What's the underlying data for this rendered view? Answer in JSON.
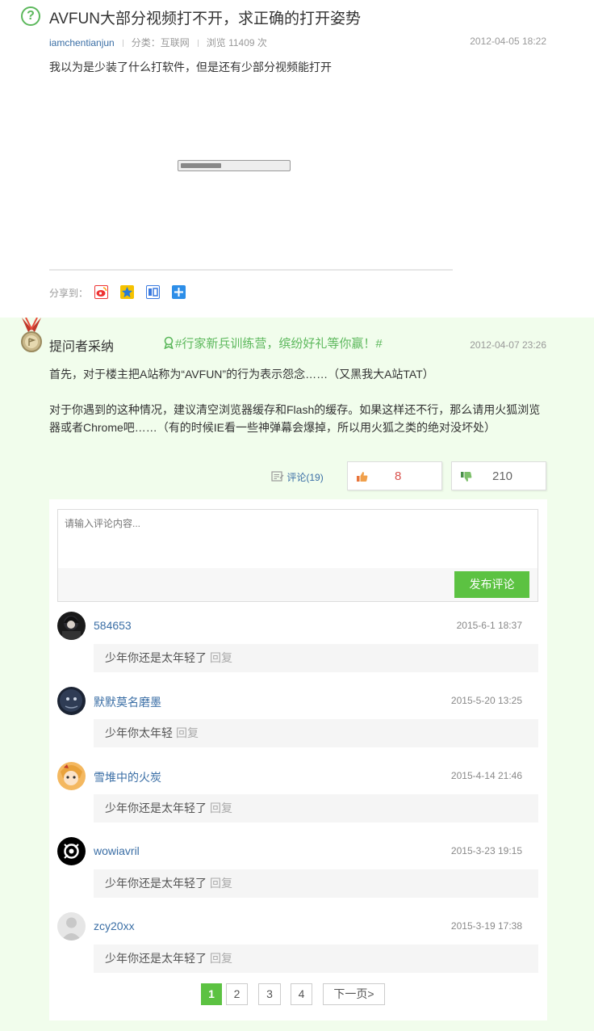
{
  "question": {
    "title": "AVFUN大部分视频打不开，求正确的打开姿势",
    "author": "iamchentianjun",
    "category": "分类：互联网",
    "views": "浏览 11409 次",
    "date": "2012-04-05 18:22",
    "body": "我以为是少装了什么打软件，但是还有少部分视频能打开",
    "share_label": "分享到："
  },
  "share_icons": [
    "weibo-icon",
    "qzone-icon",
    "tieba-icon",
    "more-share-icon"
  ],
  "answer": {
    "adopt_label": "提问者采纳",
    "promo": "#行家新兵训练营，缤纷好礼等你赢！#",
    "date": "2012-04-07 23:26",
    "para1": "首先，对于楼主把A站称为“AVFUN”的行为表示怨念……（又黑我大A站TAT）",
    "para2": "对于你遇到的这种情况，建议清空浏览器缓存和Flash的缓存。如果这样还不行，那么请用火狐浏览器或者Chrome吧……（有的时候IE看一些神弹幕会爆掉，所以用火狐之类的绝对没坏处）",
    "comment_link": "评论(19)",
    "upvotes": "8",
    "downvotes": "210"
  },
  "comment_form": {
    "placeholder": "请输入评论内容...",
    "submit_label": "发布评论"
  },
  "comments": [
    {
      "user": "584653",
      "date": "2015-6-1 18:37",
      "text": "少年你还是太年轻了",
      "reply": "回复"
    },
    {
      "user": "默默莫名磨墨",
      "date": "2015-5-20 13:25",
      "text": "少年你太年轻",
      "reply": "回复"
    },
    {
      "user": "雪堆中的火炭",
      "date": "2015-4-14 21:46",
      "text": "少年你还是太年轻了",
      "reply": "回复"
    },
    {
      "user": "wowiavril",
      "date": "2015-3-23 19:15",
      "text": "少年你还是太年轻了",
      "reply": "回复"
    },
    {
      "user": "zcy20xx",
      "date": "2015-3-19 17:38",
      "text": "少年你还是太年轻了",
      "reply": "回复"
    }
  ],
  "pagination": {
    "pages": [
      "1",
      "2",
      "3",
      "4"
    ],
    "next": "下一页>",
    "current": "1"
  },
  "colors": {
    "accent_green": "#5cc242",
    "link_blue": "#3a6ea5",
    "answer_bg": "#f1fdec"
  }
}
